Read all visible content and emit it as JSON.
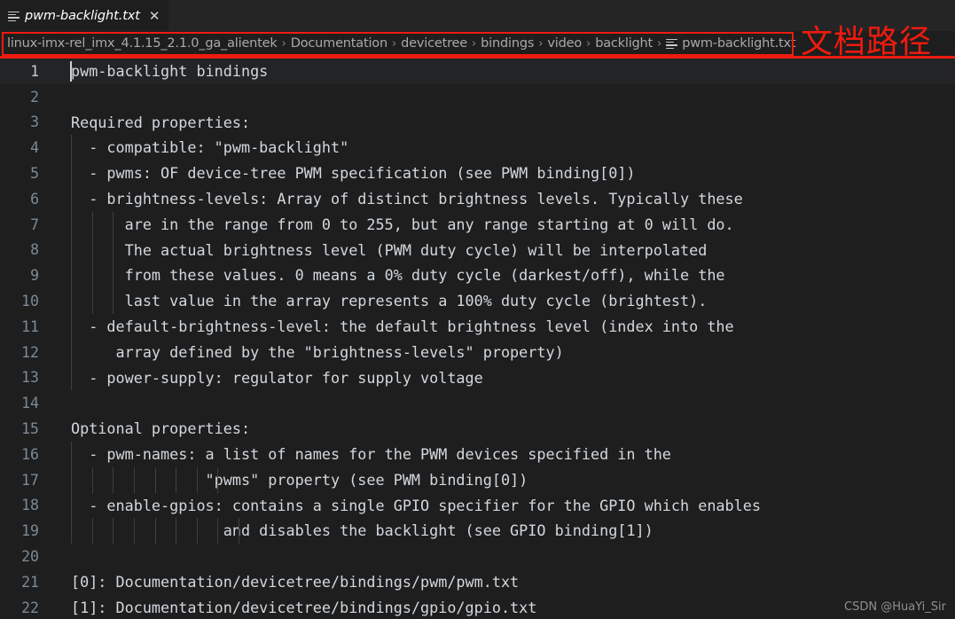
{
  "colors": {
    "editor_bg": "#1e1e1e",
    "tabbar_bg": "#252526",
    "annotation_red": "#ee1b0f",
    "line_number": "#7b8b99",
    "code_text": "#d2d8de",
    "breadcrumb_text": "#a9a9a9",
    "indent_guide": "#404040"
  },
  "tab": {
    "icon": "file-lines-icon",
    "title": "pwm-backlight.txt",
    "close_label": "✕"
  },
  "breadcrumb": {
    "separator": "›",
    "file_icon": "file-lines-icon",
    "items": [
      {
        "label": "linux-imx-rel_imx_4.1.15_2.1.0_ga_alientek"
      },
      {
        "label": "Documentation"
      },
      {
        "label": "devicetree"
      },
      {
        "label": "bindings"
      },
      {
        "label": "video"
      },
      {
        "label": "backlight"
      },
      {
        "label": "pwm-backlight.txt"
      }
    ]
  },
  "annotation": {
    "text": "文档路径"
  },
  "editor": {
    "active_line": 1,
    "lines": [
      {
        "n": "1",
        "text": "pwm-backlight bindings",
        "guides": 0
      },
      {
        "n": "2",
        "text": "",
        "guides": 0
      },
      {
        "n": "3",
        "text": "Required properties:",
        "guides": 0
      },
      {
        "n": "4",
        "text": "  - compatible: \"pwm-backlight\"",
        "guides": 1
      },
      {
        "n": "5",
        "text": "  - pwms: OF device-tree PWM specification (see PWM binding[0])",
        "guides": 1
      },
      {
        "n": "6",
        "text": "  - brightness-levels: Array of distinct brightness levels. Typically these",
        "guides": 1
      },
      {
        "n": "7",
        "text": "      are in the range from 0 to 255, but any range starting at 0 will do.",
        "guides": 3
      },
      {
        "n": "8",
        "text": "      The actual brightness level (PWM duty cycle) will be interpolated",
        "guides": 3
      },
      {
        "n": "9",
        "text": "      from these values. 0 means a 0% duty cycle (darkest/off), while the",
        "guides": 3
      },
      {
        "n": "10",
        "text": "      last value in the array represents a 100% duty cycle (brightest).",
        "guides": 3
      },
      {
        "n": "11",
        "text": "  - default-brightness-level: the default brightness level (index into the",
        "guides": 1
      },
      {
        "n": "12",
        "text": "     array defined by the \"brightness-levels\" property)",
        "guides": 1
      },
      {
        "n": "13",
        "text": "  - power-supply: regulator for supply voltage",
        "guides": 1
      },
      {
        "n": "14",
        "text": "",
        "guides": 0
      },
      {
        "n": "15",
        "text": "Optional properties:",
        "guides": 0
      },
      {
        "n": "16",
        "text": "  - pwm-names: a list of names for the PWM devices specified in the",
        "guides": 1
      },
      {
        "n": "17",
        "text": "               \"pwms\" property (see PWM binding[0])",
        "guides": 8
      },
      {
        "n": "18",
        "text": "  - enable-gpios: contains a single GPIO specifier for the GPIO which enables",
        "guides": 1
      },
      {
        "n": "19",
        "text": "                 and disables the backlight (see GPIO binding[1])",
        "guides": 9
      },
      {
        "n": "20",
        "text": "",
        "guides": 0
      },
      {
        "n": "21",
        "text": "[0]: Documentation/devicetree/bindings/pwm/pwm.txt",
        "guides": 0
      },
      {
        "n": "22",
        "text": "[1]: Documentation/devicetree/bindings/gpio/gpio.txt",
        "guides": 0
      }
    ]
  },
  "watermark": {
    "text": "CSDN @HuaYi_Sir"
  }
}
